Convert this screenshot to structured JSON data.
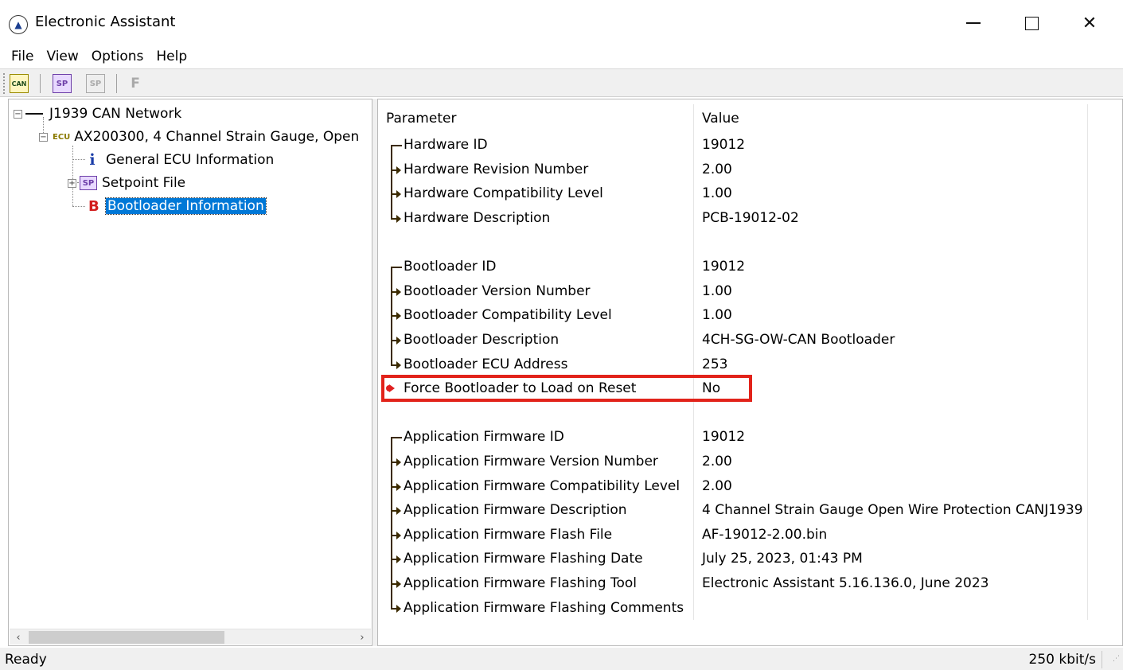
{
  "window": {
    "title": "Electronic Assistant",
    "minimize_glyph": "—",
    "close_glyph": "✕"
  },
  "menu": {
    "items": [
      "File",
      "View",
      "Options",
      "Help"
    ]
  },
  "toolbar": {
    "buttons": [
      {
        "icon": "can-connect-icon",
        "label": "CAN"
      },
      {
        "icon": "setpoint-file-icon",
        "label": "SP"
      },
      {
        "icon": "setpoint-save-icon",
        "label": "SP"
      },
      {
        "icon": "flash-icon",
        "label": "F"
      }
    ]
  },
  "tree": {
    "network": {
      "label": "J1939 CAN Network",
      "expander": "−"
    },
    "ecu": {
      "label": "AX200300, 4 Channel Strain Gauge, Open",
      "prefix": "ECU",
      "expander": "−"
    },
    "children": [
      {
        "label": "General ECU Information",
        "icon": "info-icon",
        "glyph": "i"
      },
      {
        "label": "Setpoint File",
        "icon": "setpoint-icon",
        "glyph": "SP",
        "expander": "+"
      },
      {
        "label": "Bootloader Information",
        "icon": "bootloader-icon",
        "glyph": "B",
        "selected": true
      }
    ]
  },
  "scroll": {
    "left_glyph": "‹",
    "right_glyph": "›"
  },
  "list": {
    "columns": [
      "Parameter",
      "Value"
    ],
    "rows": [
      {
        "param": "Hardware ID",
        "value": "19012",
        "conn": "first"
      },
      {
        "param": "Hardware Revision Number",
        "value": "2.00",
        "conn": "mid"
      },
      {
        "param": "Hardware Compatibility Level",
        "value": "1.00",
        "conn": "mid"
      },
      {
        "param": "Hardware Description",
        "value": "PCB-19012-02",
        "conn": "last"
      },
      {
        "param": "",
        "value": "",
        "conn": "none"
      },
      {
        "param": "Bootloader ID",
        "value": "19012",
        "conn": "first"
      },
      {
        "param": "Bootloader Version Number",
        "value": "1.00",
        "conn": "mid"
      },
      {
        "param": "Bootloader Compatibility Level",
        "value": "1.00",
        "conn": "mid"
      },
      {
        "param": "Bootloader Description",
        "value": "4CH-SG-OW-CAN Bootloader",
        "conn": "mid"
      },
      {
        "param": "Bootloader ECU Address",
        "value": "253",
        "conn": "last"
      },
      {
        "param": "Force Bootloader to Load on Reset",
        "value": "No",
        "conn": "red"
      },
      {
        "param": "",
        "value": "",
        "conn": "none"
      },
      {
        "param": "Application Firmware ID",
        "value": "19012",
        "conn": "first"
      },
      {
        "param": "Application Firmware Version Number",
        "value": "2.00",
        "conn": "mid"
      },
      {
        "param": "Application Firmware Compatibility Level",
        "value": "2.00",
        "conn": "mid"
      },
      {
        "param": "Application Firmware Description",
        "value": "4 Channel Strain Gauge Open Wire Protection CANJ1939",
        "conn": "mid"
      },
      {
        "param": "Application Firmware Flash File",
        "value": "AF-19012-2.00.bin",
        "conn": "mid"
      },
      {
        "param": "Application Firmware Flashing Date",
        "value": "July 25, 2023, 01:43 PM",
        "conn": "mid"
      },
      {
        "param": "Application Firmware Flashing Tool",
        "value": "Electronic Assistant 5.16.136.0, June 2023",
        "conn": "mid"
      },
      {
        "param": "Application Firmware Flashing Comments",
        "value": "",
        "conn": "last"
      }
    ]
  },
  "status": {
    "left": "Ready",
    "right": "250 kbit/s"
  },
  "colors": {
    "selection": "#0078d7",
    "highlight_box": "#e2231a",
    "setpoint_purple": "#6d3ea8"
  }
}
